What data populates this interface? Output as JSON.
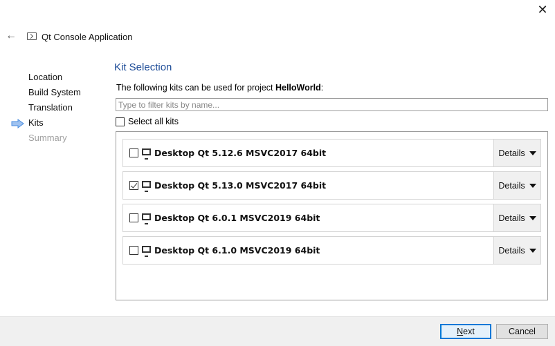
{
  "window": {
    "close_glyph": "✕",
    "back_glyph": "←",
    "title": "Qt Console Application",
    "title_icon": "terminal-icon"
  },
  "nav": {
    "items": [
      {
        "label": "Location",
        "state": "done"
      },
      {
        "label": "Build System",
        "state": "done"
      },
      {
        "label": "Translation",
        "state": "done"
      },
      {
        "label": "Kits",
        "state": "current"
      },
      {
        "label": "Summary",
        "state": "disabled"
      }
    ],
    "current_indicator_icon": "right-arrow-icon",
    "indicator_color": "#4a8de0"
  },
  "page": {
    "heading": "Kit Selection",
    "heading_color": "#1c4b97",
    "desc_prefix": "The following kits can be used for project ",
    "project_name": "HelloWorld",
    "desc_suffix": ":",
    "filter": {
      "value": "",
      "placeholder": "Type to filter kits by name..."
    },
    "select_all": {
      "label": "Select all kits",
      "checked": false
    }
  },
  "kits": [
    {
      "name": "Desktop Qt 5.12.6 MSVC2017 64bit",
      "checked": false,
      "details_label": "Details"
    },
    {
      "name": "Desktop Qt 5.13.0 MSVC2017 64bit",
      "checked": true,
      "details_label": "Details"
    },
    {
      "name": "Desktop Qt 6.0.1 MSVC2019 64bit",
      "checked": false,
      "details_label": "Details"
    },
    {
      "name": "Desktop Qt 6.1.0 MSVC2019 64bit",
      "checked": false,
      "details_label": "Details"
    }
  ],
  "footer": {
    "next_label": "Next",
    "cancel_label": "Cancel",
    "accent": "#0078d7"
  }
}
